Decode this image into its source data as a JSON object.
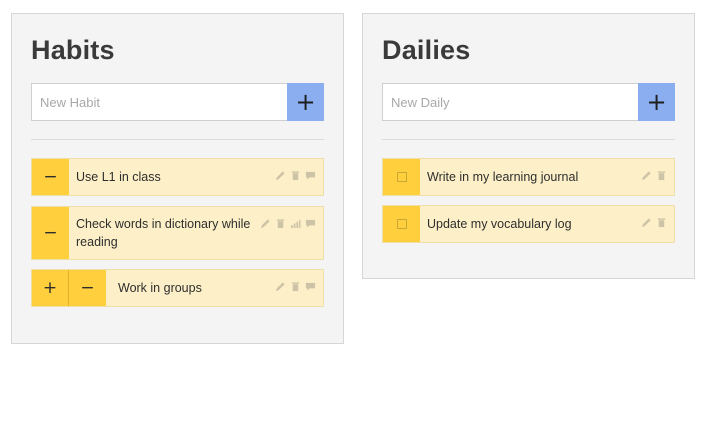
{
  "habits": {
    "title": "Habits",
    "new_placeholder": "New Habit",
    "add_label": "+",
    "items": [
      {
        "text": "Use L1 in class",
        "controls": [
          "−"
        ]
      },
      {
        "text": "Check words in dictionary while reading",
        "controls": [
          "−"
        ]
      },
      {
        "text": "Work in groups",
        "controls": [
          "+",
          "−"
        ]
      }
    ]
  },
  "dailies": {
    "title": "Dailies",
    "new_placeholder": "New Daily",
    "add_label": "+",
    "items": [
      {
        "text": "Write in my learning journal"
      },
      {
        "text": "Update my vocabulary log"
      }
    ]
  },
  "icons": {
    "edit": "pencil-icon",
    "delete": "trash-icon",
    "stats": "bar-chart-icon",
    "notes": "comment-icon"
  },
  "colors": {
    "add_button": "#8aaef0",
    "task_control": "#ffcf3d",
    "task_background": "#fdf0c8"
  }
}
